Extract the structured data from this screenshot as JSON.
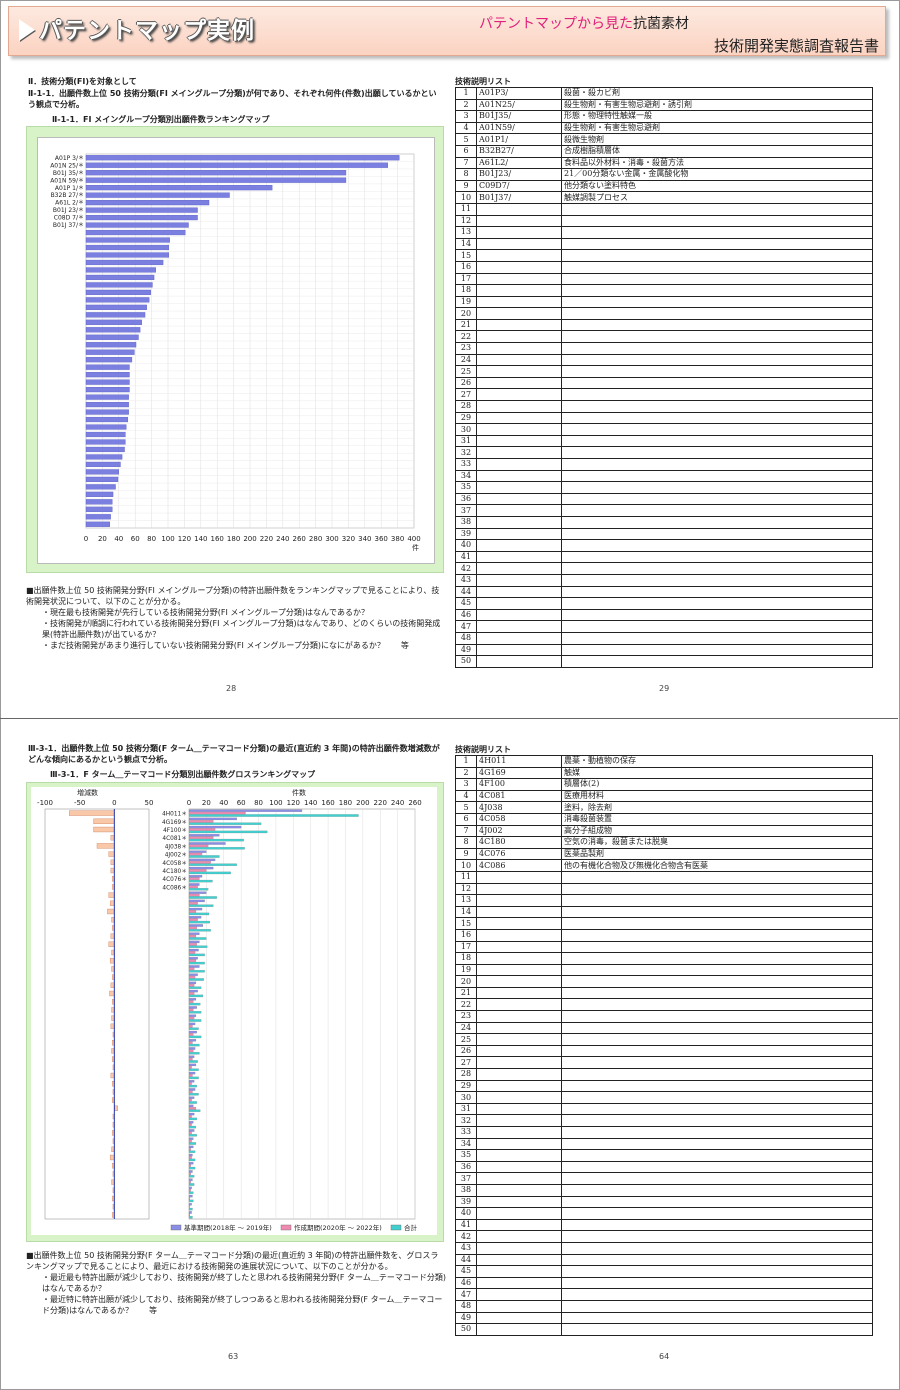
{
  "header": {
    "title": "パテントマップ実例",
    "subtitle_pink": "パテントマップから見た",
    "subtitle_topic": "抗菌素材",
    "report_title": "技術開発実態調査報告書"
  },
  "page1": {
    "heading": "Ⅱ．技術分類(FI)を対象として",
    "section": "Ⅱ-1-1．出願件数上位 50 技術分類(FI メイングループ分類)が何であり、それぞれ何件(件数)出願しているかという観点で分析。",
    "chart_title": "Ⅱ-1-1．FI メイングループ分類別出願件数ランキングマップ",
    "notes": [
      "■出願件数上位 50 技術開発分野(FI メイングループ分類)の特許出願件数をランキングマップで見ることにより、技術開発状況について、以下のことが分かる。",
      "・現在最も技術開発が先行している技術開発分野(FI メイングループ分類)はなんであるか？",
      "・技術開発が順調に行われている技術開発分野(FI メイングループ分類)はなんであり、どのくらいの技術開発成果(特許出願件数)が出ているか？",
      "・まだ技術開発があまり進行していない技術開発分野(FI メイングループ分類)になにがあるか？　　等"
    ],
    "page_left": "28",
    "page_right": "29"
  },
  "page2": {
    "section": "Ⅲ-3-1．出願件数上位 50 技術分類(F ターム＿テーマコード分類)の最近(直近約 3 年間)の特許出願件数増減数がどんな傾向にあるかという観点で分析。",
    "chart_title": "Ⅲ-3-1．F ターム＿テーマコード分類別出願件数グロスランキングマップ",
    "notes": [
      "■出願件数上位 50 技術開発分野(F ターム＿テーマコード分類)の最近(直近約 3 年間)の特許出願件数を、グロスランキングマップで見ることにより、最近における技術開発の進展状況について、以下のことが分かる。",
      "・最近最も特許出願が減少しており、技術開発が終了したと思われる技術開発分野(F ターム＿テーマコード分類)はなんであるか？",
      "・最近特に特許出願が減少しており、技術開発が終了しつつあると思われる技術開発分野(F ターム＿テーマコード分類)はなんであるか？　　等"
    ],
    "page_left": "63",
    "page_right": "64"
  },
  "list1": {
    "title": "技術説明リスト",
    "rows": [
      {
        "no": "1",
        "code": "A01P3/",
        "desc": "殺菌・殺カビ剤"
      },
      {
        "no": "2",
        "code": "A01N25/",
        "desc": "殺生物剤・有害生物忌避剤・誘引剤"
      },
      {
        "no": "3",
        "code": "B01J35/",
        "desc": "形態・物理特性触媒一般"
      },
      {
        "no": "4",
        "code": "A01N59/",
        "desc": "殺生物剤・有害生物忌避剤"
      },
      {
        "no": "5",
        "code": "A01P1/",
        "desc": "殺微生物剤"
      },
      {
        "no": "6",
        "code": "B32B27/",
        "desc": "合成樹脂積層体"
      },
      {
        "no": "7",
        "code": "A61L2/",
        "desc": "食料品以外材料・消毒・殺菌方法"
      },
      {
        "no": "8",
        "code": "B01J23/",
        "desc": "21／00分類ない金属・金属酸化物"
      },
      {
        "no": "9",
        "code": "C09D7/",
        "desc": "他分類ない塗料特色"
      },
      {
        "no": "10",
        "code": "B01J37/",
        "desc": "触媒調製プロセス"
      },
      {
        "no": "11",
        "code": "",
        "desc": ""
      },
      {
        "no": "12",
        "code": "",
        "desc": ""
      },
      {
        "no": "13",
        "code": "",
        "desc": ""
      },
      {
        "no": "14",
        "code": "",
        "desc": ""
      },
      {
        "no": "15",
        "code": "",
        "desc": ""
      },
      {
        "no": "16",
        "code": "",
        "desc": ""
      },
      {
        "no": "17",
        "code": "",
        "desc": ""
      },
      {
        "no": "18",
        "code": "",
        "desc": ""
      },
      {
        "no": "19",
        "code": "",
        "desc": ""
      },
      {
        "no": "20",
        "code": "",
        "desc": ""
      },
      {
        "no": "21",
        "code": "",
        "desc": ""
      },
      {
        "no": "22",
        "code": "",
        "desc": ""
      },
      {
        "no": "23",
        "code": "",
        "desc": ""
      },
      {
        "no": "24",
        "code": "",
        "desc": ""
      },
      {
        "no": "25",
        "code": "",
        "desc": ""
      },
      {
        "no": "26",
        "code": "",
        "desc": ""
      },
      {
        "no": "27",
        "code": "",
        "desc": ""
      },
      {
        "no": "28",
        "code": "",
        "desc": ""
      },
      {
        "no": "29",
        "code": "",
        "desc": ""
      },
      {
        "no": "30",
        "code": "",
        "desc": ""
      },
      {
        "no": "31",
        "code": "",
        "desc": ""
      },
      {
        "no": "32",
        "code": "",
        "desc": ""
      },
      {
        "no": "33",
        "code": "",
        "desc": ""
      },
      {
        "no": "34",
        "code": "",
        "desc": ""
      },
      {
        "no": "35",
        "code": "",
        "desc": ""
      },
      {
        "no": "36",
        "code": "",
        "desc": ""
      },
      {
        "no": "37",
        "code": "",
        "desc": ""
      },
      {
        "no": "38",
        "code": "",
        "desc": ""
      },
      {
        "no": "39",
        "code": "",
        "desc": ""
      },
      {
        "no": "40",
        "code": "",
        "desc": ""
      },
      {
        "no": "41",
        "code": "",
        "desc": ""
      },
      {
        "no": "42",
        "code": "",
        "desc": ""
      },
      {
        "no": "43",
        "code": "",
        "desc": ""
      },
      {
        "no": "44",
        "code": "",
        "desc": ""
      },
      {
        "no": "45",
        "code": "",
        "desc": ""
      },
      {
        "no": "46",
        "code": "",
        "desc": ""
      },
      {
        "no": "47",
        "code": "",
        "desc": ""
      },
      {
        "no": "48",
        "code": "",
        "desc": ""
      },
      {
        "no": "49",
        "code": "",
        "desc": ""
      },
      {
        "no": "50",
        "code": "",
        "desc": ""
      }
    ]
  },
  "list2": {
    "title": "技術説明リスト",
    "rows": [
      {
        "no": "1",
        "code": "4H011",
        "desc": "農薬・動植物の保存"
      },
      {
        "no": "2",
        "code": "4G169",
        "desc": "触媒"
      },
      {
        "no": "3",
        "code": "4F100",
        "desc": "積層体(2)"
      },
      {
        "no": "4",
        "code": "4C081",
        "desc": "医療用材料"
      },
      {
        "no": "5",
        "code": "4J038",
        "desc": "塗料，除去剤"
      },
      {
        "no": "6",
        "code": "4C058",
        "desc": "消毒殺菌装置"
      },
      {
        "no": "7",
        "code": "4J002",
        "desc": "高分子組成物"
      },
      {
        "no": "8",
        "code": "4C180",
        "desc": "空気の消毒，殺菌または脱臭"
      },
      {
        "no": "9",
        "code": "4C076",
        "desc": "医薬品製剤"
      },
      {
        "no": "10",
        "code": "4C086",
        "desc": "他の有機化合物及び無機化合物含有医薬"
      },
      {
        "no": "11",
        "code": "",
        "desc": ""
      },
      {
        "no": "12",
        "code": "",
        "desc": ""
      },
      {
        "no": "13",
        "code": "",
        "desc": ""
      },
      {
        "no": "14",
        "code": "",
        "desc": ""
      },
      {
        "no": "15",
        "code": "",
        "desc": ""
      },
      {
        "no": "16",
        "code": "",
        "desc": ""
      },
      {
        "no": "17",
        "code": "",
        "desc": ""
      },
      {
        "no": "18",
        "code": "",
        "desc": ""
      },
      {
        "no": "19",
        "code": "",
        "desc": ""
      },
      {
        "no": "20",
        "code": "",
        "desc": ""
      },
      {
        "no": "21",
        "code": "",
        "desc": ""
      },
      {
        "no": "22",
        "code": "",
        "desc": ""
      },
      {
        "no": "23",
        "code": "",
        "desc": ""
      },
      {
        "no": "24",
        "code": "",
        "desc": ""
      },
      {
        "no": "25",
        "code": "",
        "desc": ""
      },
      {
        "no": "26",
        "code": "",
        "desc": ""
      },
      {
        "no": "27",
        "code": "",
        "desc": ""
      },
      {
        "no": "28",
        "code": "",
        "desc": ""
      },
      {
        "no": "29",
        "code": "",
        "desc": ""
      },
      {
        "no": "30",
        "code": "",
        "desc": ""
      },
      {
        "no": "31",
        "code": "",
        "desc": ""
      },
      {
        "no": "32",
        "code": "",
        "desc": ""
      },
      {
        "no": "33",
        "code": "",
        "desc": ""
      },
      {
        "no": "34",
        "code": "",
        "desc": ""
      },
      {
        "no": "35",
        "code": "",
        "desc": ""
      },
      {
        "no": "36",
        "code": "",
        "desc": ""
      },
      {
        "no": "37",
        "code": "",
        "desc": ""
      },
      {
        "no": "38",
        "code": "",
        "desc": ""
      },
      {
        "no": "39",
        "code": "",
        "desc": ""
      },
      {
        "no": "40",
        "code": "",
        "desc": ""
      },
      {
        "no": "41",
        "code": "",
        "desc": ""
      },
      {
        "no": "42",
        "code": "",
        "desc": ""
      },
      {
        "no": "43",
        "code": "",
        "desc": ""
      },
      {
        "no": "44",
        "code": "",
        "desc": ""
      },
      {
        "no": "45",
        "code": "",
        "desc": ""
      },
      {
        "no": "46",
        "code": "",
        "desc": ""
      },
      {
        "no": "47",
        "code": "",
        "desc": ""
      },
      {
        "no": "48",
        "code": "",
        "desc": ""
      },
      {
        "no": "49",
        "code": "",
        "desc": ""
      },
      {
        "no": "50",
        "code": "",
        "desc": ""
      }
    ]
  },
  "chart_data": [
    {
      "type": "bar",
      "orientation": "horizontal",
      "categories": [
        "A01P 3/＊",
        "A01N 25/＊",
        "B01J 35/＊",
        "A01N 59/＊",
        "A01P 1/＊",
        "B32B 27/＊",
        "A61L 2/＊",
        "B01J 23/＊",
        "C08D 7/＊",
        "B01J 37/＊"
      ],
      "values": [
        382,
        368,
        317,
        317,
        227,
        175,
        150,
        136,
        136,
        125,
        121,
        102,
        101,
        101,
        94,
        85,
        83,
        81,
        79,
        77,
        74,
        72,
        68,
        66,
        64,
        61,
        59,
        56,
        53,
        53,
        53,
        53,
        52,
        52,
        52,
        51,
        49,
        48,
        48,
        47,
        44,
        42,
        40,
        39,
        36,
        33,
        32,
        32,
        30,
        29
      ],
      "xlim": [
        0,
        400
      ],
      "xticks": [
        0,
        20,
        40,
        60,
        80,
        100,
        120,
        140,
        160,
        180,
        200,
        220,
        240,
        260,
        280,
        300,
        320,
        340,
        360,
        380,
        400
      ],
      "xlabel": "件",
      "color": "#7b7fe0"
    },
    {
      "type": "bar",
      "orientation": "horizontal",
      "categories": [
        "4H011＊",
        "4G169＊",
        "4F100＊",
        "4C081＊",
        "4J038＊",
        "4J002＊",
        "4C058＊",
        "4C180＊",
        "4C076＊",
        "4C086＊"
      ],
      "left_panel": {
        "title": "増減数",
        "xlim": [
          -100,
          50
        ],
        "xticks": [
          -100,
          -50,
          0,
          50
        ],
        "values": [
          -65,
          -30,
          -30,
          -5,
          -25,
          -8,
          -5,
          -5,
          -3,
          -3,
          -8,
          -6,
          -10,
          -4,
          -3,
          -5,
          -8,
          -4,
          -6,
          -4,
          -3,
          -5,
          -7,
          -3,
          -4,
          -4,
          -5,
          -2,
          -3,
          -4,
          -3,
          -2,
          -5,
          -3,
          -2,
          -3,
          5,
          -2,
          -2,
          -3,
          -2,
          -4,
          -6,
          -3,
          -2,
          -4,
          -2,
          -3,
          -2,
          -3
        ]
      },
      "right_panel": {
        "title": "件数",
        "xlim": [
          0,
          260
        ],
        "xticks": [
          0,
          20,
          40,
          60,
          80,
          100,
          120,
          140,
          160,
          180,
          200,
          220,
          240,
          260
        ],
        "series": [
          {
            "name": "基準期間(2018年 ～ 2019年)",
            "color": "#8a8ee6",
            "values": [
              130,
              55,
              60,
              35,
              42,
              20,
              30,
              28,
              15,
              12,
              20,
              18,
              15,
              14,
              16,
              12,
              12,
              11,
              10,
              12,
              10,
              8,
              10,
              8,
              9,
              8,
              7,
              9,
              8,
              7,
              6,
              8,
              7,
              6,
              7,
              6,
              5,
              6,
              5,
              6,
              5,
              5,
              4,
              5,
              4,
              4,
              3,
              4,
              3,
              3
            ]
          },
          {
            "name": "作成期間(2020年 ～ 2022年)",
            "color": "#f08ab0",
            "values": [
              65,
              28,
              30,
              28,
              22,
              15,
              25,
              20,
              12,
              10,
              12,
              10,
              8,
              10,
              9,
              8,
              9,
              7,
              8,
              6,
              7,
              6,
              6,
              5,
              5,
              6,
              4,
              5,
              4,
              5,
              4,
              3,
              4,
              3,
              4,
              3,
              8,
              3,
              3,
              3,
              3,
              2,
              3,
              2,
              2,
              2,
              2,
              1,
              1,
              1
            ]
          },
          {
            "name": "合計",
            "color": "#40d0d0",
            "values": [
              195,
              83,
              90,
              63,
              64,
              35,
              55,
              48,
              27,
              22,
              32,
              28,
              23,
              24,
              25,
              20,
              21,
              18,
              18,
              18,
              17,
              14,
              16,
              13,
              14,
              14,
              11,
              14,
              12,
              12,
              10,
              11,
              11,
              9,
              11,
              9,
              13,
              9,
              8,
              9,
              8,
              7,
              7,
              7,
              6,
              6,
              5,
              5,
              4,
              4
            ]
          }
        ]
      }
    }
  ]
}
